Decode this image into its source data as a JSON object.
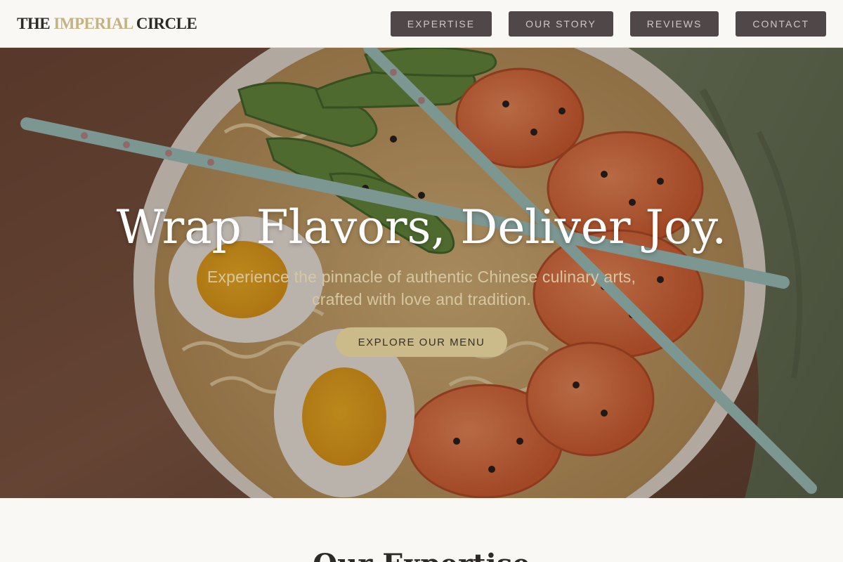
{
  "brand": {
    "part1": "THE ",
    "accent": "IMPERIAL",
    "part2": " CIRCLE"
  },
  "nav": [
    {
      "label": "EXPERTISE"
    },
    {
      "label": "OUR STORY"
    },
    {
      "label": "REVIEWS"
    },
    {
      "label": "CONTACT"
    }
  ],
  "hero": {
    "title": "Wrap Flavors, Deliver Joy.",
    "subtitle": "Experience the pinnacle of authentic Chinese culinary arts, crafted with love and tradition.",
    "cta": "EXPLORE OUR MENU",
    "image_icon": "ramen-bowl-photo"
  },
  "section": {
    "title": "Our Expertise"
  },
  "colors": {
    "background": "#faf8f5",
    "accent": "#c4b280",
    "nav_button": "#4f4748",
    "cta": "#cbba8a",
    "subtitle": "#d7c7a0"
  }
}
